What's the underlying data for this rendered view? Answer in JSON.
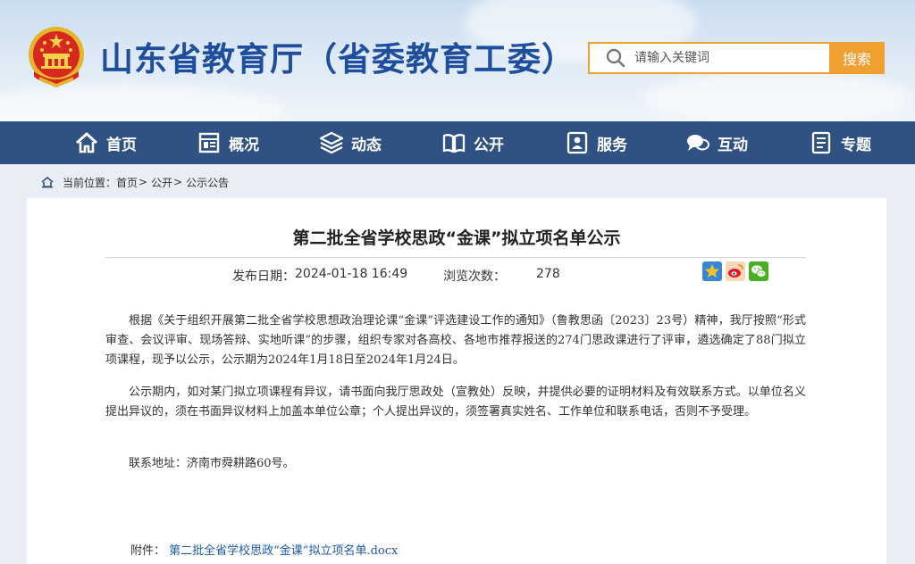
{
  "header": {
    "site_title": "山东省教育厅（省委教育工委）",
    "search": {
      "placeholder": "请输入关键词",
      "button_label": "搜索"
    },
    "colors": {
      "title": "#1f4f9c",
      "search_accent": "#f0a030",
      "nav_bg": "#2f5283",
      "link": "#1f5aa8"
    }
  },
  "nav": {
    "items": [
      {
        "label": "首页",
        "icon": "home-icon"
      },
      {
        "label": "概况",
        "icon": "overview-icon"
      },
      {
        "label": "动态",
        "icon": "news-stack-icon"
      },
      {
        "label": "公开",
        "icon": "open-book-icon"
      },
      {
        "label": "服务",
        "icon": "service-icon"
      },
      {
        "label": "互动",
        "icon": "chat-icon"
      },
      {
        "label": "专题",
        "icon": "topic-icon"
      }
    ]
  },
  "breadcrumb": {
    "prefix": "当前位置：",
    "items": [
      "首页",
      "公开",
      "公示公告"
    ],
    "separator": ">",
    "icon": "location-home-icon"
  },
  "article": {
    "title": "第二批全省学校思政“金课”拟立项名单公示",
    "publish_label": "发布日期：",
    "publish_date": "2024-01-18 16:49",
    "views_label": "浏览次数：",
    "views": "278",
    "share_icons": [
      "qzone-star-icon",
      "weibo-icon",
      "wechat-icon"
    ],
    "paragraphs": [
      "根据《关于组织开展第二批全省学校思想政治理论课“金课”评选建设工作的通知》（鲁教思函〔2023〕23号）精神，我厅按照“形式审查、会议评审、现场答辩、实地听课”的步骤，组织专家对各高校、各地市推荐报送的274门思政课进行了评审，遴选确定了88门拟立项课程，现予以公示，公示期为2024年1月18日至2024年1月24日。",
      "公示期内，如对某门拟立项课程有异议，请书面向我厅思政处（宣教处）反映，并提供必要的证明材料及有效联系方式。以单位名义提出异议的，须在书面异议材料上加盖本单位公章；个人提出异议的，须签署真实姓名、工作单位和联系电话，否则不予受理。",
      "联系地址：济南市舜耕路60号。"
    ],
    "attachment_label": "附件：",
    "attachment_file": "第二批全省学校思政“金课”拟立项名单.docx"
  }
}
